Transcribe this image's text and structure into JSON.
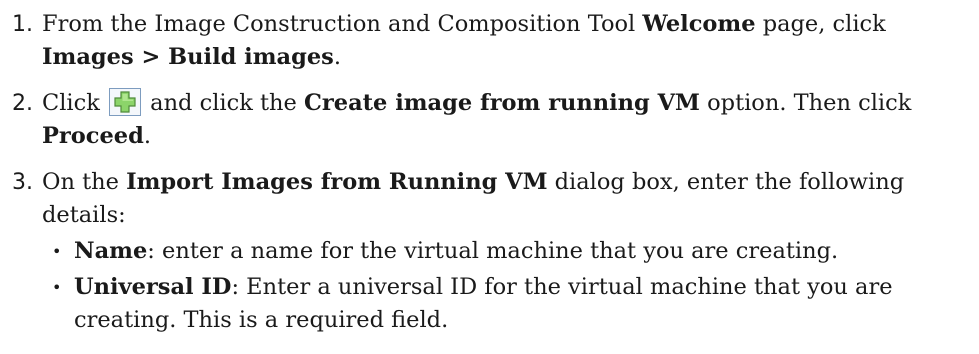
{
  "steps": [
    {
      "number": "1.",
      "t1": "From the Image Construction and Composition Tool ",
      "b1": "Welcome",
      "t2": " page, click ",
      "b2": "Images > Build images",
      "t3": "."
    },
    {
      "number": "2.",
      "t1": "Click ",
      "icon": "add-plus-icon",
      "t2": " and click the ",
      "b1": "Create image from running VM",
      "t3": " option. Then click ",
      "b2": "Proceed",
      "t4": "."
    },
    {
      "number": "3.",
      "t1": "On the ",
      "b1": "Import Images from Running VM",
      "t2": " dialog box, enter the following details:",
      "bullets": [
        {
          "mark": "•",
          "label": "Name",
          "text": ": enter a name for the virtual machine that you are creating."
        },
        {
          "mark": "•",
          "label": "Universal ID",
          "text": ": Enter a universal ID for the virtual machine that you are creating. This is a required field."
        }
      ]
    }
  ],
  "colors": {
    "text": "#1a1a1a",
    "icon_fill": "#8cd46a",
    "icon_border": "#4f8a3a",
    "icon_frame": "#7d9cbf"
  }
}
